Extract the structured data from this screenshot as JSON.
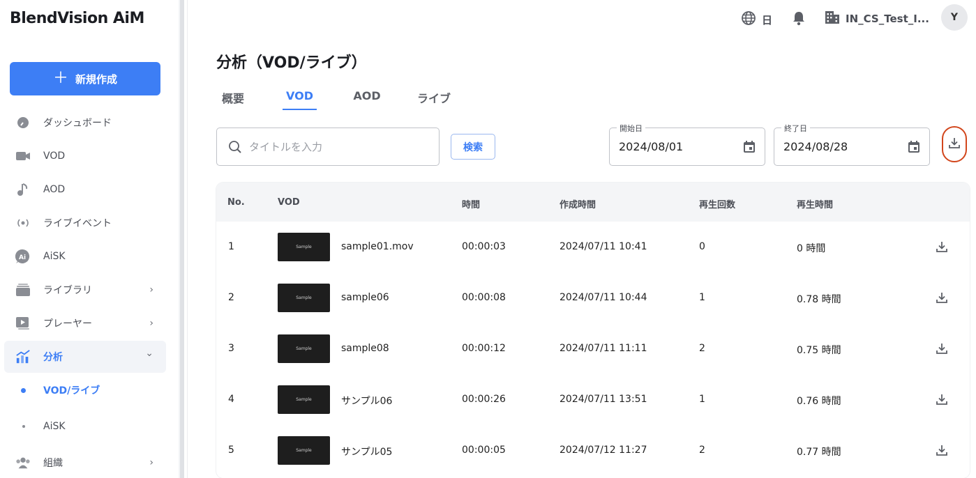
{
  "brand": "BlendVision AiM",
  "new_button": {
    "plus": "＋",
    "label": "新規作成"
  },
  "sidebar": {
    "items": [
      {
        "label": "ダッシュボード"
      },
      {
        "label": "VOD"
      },
      {
        "label": "AOD"
      },
      {
        "label": "ライブイベント"
      },
      {
        "label": "AiSK"
      },
      {
        "label": "ライブラリ",
        "chevron": "›"
      },
      {
        "label": "プレーヤー",
        "chevron": "›"
      },
      {
        "label": "分析",
        "chevron": "⌄"
      },
      {
        "label": "組織",
        "chevron": "›"
      }
    ],
    "sub_items": [
      {
        "label": "VOD/ライブ"
      },
      {
        "label": "AiSK"
      }
    ]
  },
  "topbar": {
    "language": "日",
    "org_name": "IN_CS_Test_I...",
    "avatar": "Y"
  },
  "page": {
    "title": "分析（VOD/ライブ）",
    "tabs": [
      "概要",
      "VOD",
      "AOD",
      "ライブ"
    ]
  },
  "search": {
    "placeholder": "タイトルを入力",
    "button": "検索"
  },
  "dates": {
    "start_label": "開始日",
    "start_value": "2024/08/01",
    "end_label": "終了日",
    "end_value": "2024/08/28"
  },
  "table": {
    "headers": [
      "No.",
      "VOD",
      "時間",
      "作成時間",
      "再生回数",
      "再生時間"
    ],
    "thumb_text": "Sample",
    "rows": [
      {
        "no": "1",
        "title": "sample01.mov",
        "duration": "00:00:03",
        "created": "2024/07/11 10:41",
        "plays": "0",
        "watch": "0 時間"
      },
      {
        "no": "2",
        "title": "sample06",
        "duration": "00:00:08",
        "created": "2024/07/11 10:44",
        "plays": "1",
        "watch": "0.78 時間"
      },
      {
        "no": "3",
        "title": "sample08",
        "duration": "00:00:12",
        "created": "2024/07/11 11:11",
        "plays": "2",
        "watch": "0.75 時間"
      },
      {
        "no": "4",
        "title": "サンプル06",
        "duration": "00:00:26",
        "created": "2024/07/11 13:51",
        "plays": "1",
        "watch": "0.76 時間"
      },
      {
        "no": "5",
        "title": "サンプル05",
        "duration": "00:00:05",
        "created": "2024/07/12 11:27",
        "plays": "2",
        "watch": "0.77 時間"
      }
    ]
  },
  "colors": {
    "accent": "#3d7ef5",
    "highlight": "#d2461c"
  }
}
